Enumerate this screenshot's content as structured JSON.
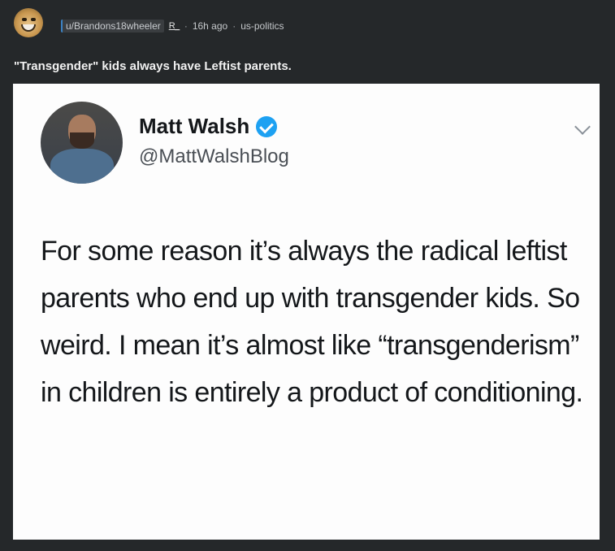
{
  "post": {
    "username": "u/Brandons18wheeler",
    "flair": "R_",
    "separator": "·",
    "time": "16h ago",
    "community": "us-politics",
    "title": "\"Transgender\" kids always have Leftist parents."
  },
  "tweet": {
    "name": "Matt Walsh",
    "handle": "@MattWalshBlog",
    "text": "For some reason it’s always the radical leftist parents who end up with transgender kids. So weird. I mean it’s almost like “transgenderism” in children is entirely a product of conditioning."
  },
  "icons": {
    "verified": "verified-badge-icon",
    "menu": "chevron-down-icon"
  },
  "colors": {
    "background": "#25282a",
    "username_accent": "#3b82c4",
    "verified_blue": "#1da1f2"
  }
}
